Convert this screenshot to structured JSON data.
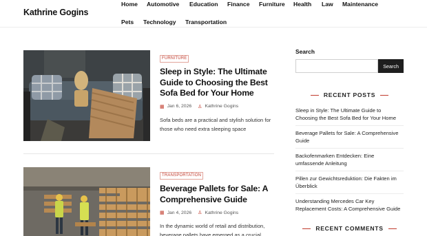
{
  "site": {
    "title": "Kathrine Gogins"
  },
  "nav": {
    "items": [
      "Home",
      "Automotive",
      "Education",
      "Finance",
      "Furniture",
      "Health",
      "Law",
      "Maintenance",
      "Pets",
      "Technology",
      "Transportation"
    ]
  },
  "posts": [
    {
      "category": "FURNITURE",
      "title": "Sleep in Style: The Ultimate Guide to Choosing the Best Sofa Bed for Your Home",
      "date": "Jan 6, 2026",
      "author": "Kathrine Gogins",
      "excerpt": "Sofa beds are a practical and stylish solution for those who need extra sleeping space",
      "image": "sofa-photo"
    },
    {
      "category": "TRANSPORTATION",
      "title": "Beverage Pallets for Sale: A Comprehensive Guide",
      "date": "Jan 4, 2026",
      "author": "Kathrine Gogins",
      "excerpt": "In the dynamic world of retail and distribution, beverage pallets have emerged as a crucial",
      "image": "pallets-photo"
    }
  ],
  "sidebar": {
    "search_label": "Search",
    "search_placeholder": "",
    "search_button": "Search",
    "recent_posts_title": "RECENT POSTS",
    "recent_posts": [
      "Sleep in Style: The Ultimate Guide to Choosing the Best Sofa Bed for Your Home",
      "Beverage Pallets for Sale: A Comprehensive Guide",
      "Backofenmarken Entdecken: Eine umfassende Anleitung",
      "Pillen zur Gewichtsreduktion: Die Fakten im Überblick",
      "Understanding Mercedes Car Key Replacement Costs: A Comprehensive Guide"
    ],
    "recent_comments_title": "RECENT COMMENTS"
  },
  "icons": {
    "date": "calendar-icon",
    "author": "user-icon"
  },
  "colors": {
    "accent": "#c0392b",
    "button": "#1e1e1e"
  }
}
